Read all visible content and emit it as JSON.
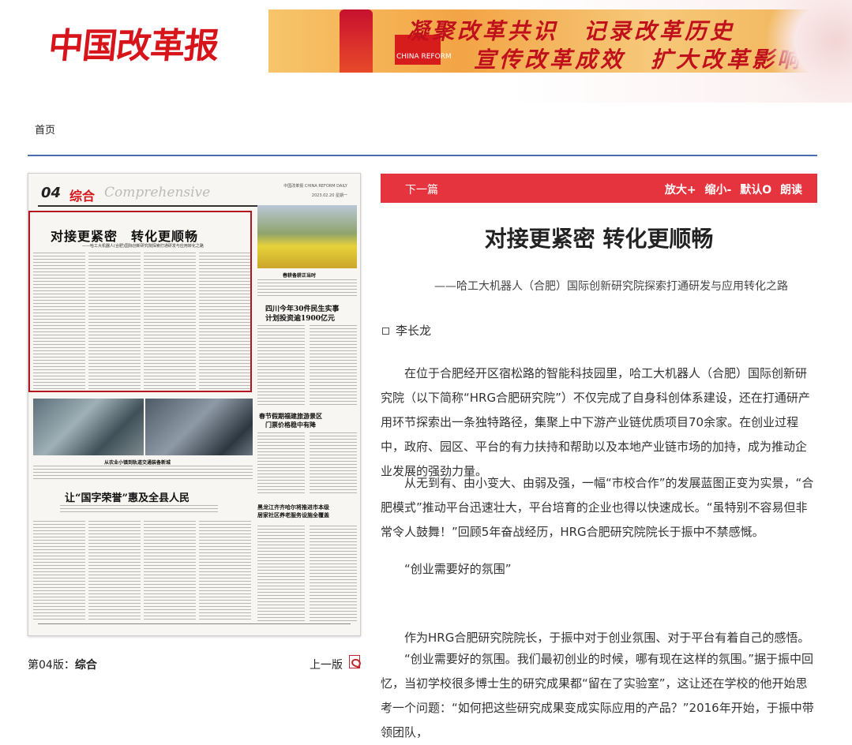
{
  "header": {
    "logo": "中国改革报",
    "banner_line1": "凝聚改革共识　记录改革历史",
    "banner_line2": "宣传改革成效　扩大改革影响",
    "banner_flag_text": "CHINA REFORM"
  },
  "nav": {
    "home": "首页"
  },
  "paper": {
    "page_num": "04",
    "section": "综合",
    "section_en": "Comprehensive",
    "meta_line1": "中国改革报 CHINA REFORM DAILY",
    "meta_line2": "2023.02.20 星期一",
    "headline": "对接更紧密　转化更顺畅",
    "subhead": "——哈工大机器人(合肥)国际创新研究院探索打通研发与应用转化之路",
    "photo1_caption": "春耕备耕正当时",
    "headline2": "四川今年30件民生实事",
    "headline2b": "计划投资逾1900亿元",
    "photo2_caption": "从农业小镇到轨道交通装备新城",
    "headline3": "让“国字荣誉”惠及全县人民",
    "headline4": "春节假期福建旅游景区",
    "headline4b": "门票价格稳中有降",
    "headline5": "黑龙江齐齐哈尔将推进市本级",
    "headline5b": "居家社区养老服务设施全覆盖"
  },
  "edition": {
    "label": "第04版：",
    "name": "综合",
    "prev": "上一版"
  },
  "article": {
    "next": "下一篇",
    "zoom_in": "放大+",
    "zoom_out": "缩小-",
    "default": "默认O",
    "read": "朗读",
    "title": "对接更紧密 转化更顺畅",
    "subtitle": "——哈工大机器人（合肥）国际创新研究院探索打通研发与应用转化之路",
    "author": "李长龙",
    "paragraphs": [
      "在位于合肥经开区宿松路的智能科技园里，哈工大机器人（合肥）国际创新研究院（以下简称“HRG合肥研究院”）不仅完成了自身科创体系建设，还在打通研产用环节探索出一条独特路径，集聚上中下游产业链优质项目70余家。在创业过程中，政府、园区、平台的有力扶持和帮助以及本地产业链市场的加持，成为推动企业发展的强劲力量。",
      "从无到有、由小变大、由弱及强，一幅“市校合作”的发展蓝图正变为实景，“合肥模式”推动平台迅速壮大，平台培育的企业也得以快速成长。“虽特别不容易但非常令人鼓舞！”回顾5年奋战经历，HRG合肥研究院院长于振中不禁感慨。",
      "“创业需要好的氛围”",
      "作为HRG合肥研究院院长，于振中对于创业氛围、对于平台有着自己的感悟。",
      "“创业需要好的氛围。我们最初创业的时候，哪有现在这样的氛围。”据于振中回忆，当初学校很多博士生的研究成果都“留在了实验室”，这让还在学校的他开始思考一个问题：“如何把这些研究成果变成实际应用的产品？”2016年开始，于振中带领团队，"
    ]
  }
}
